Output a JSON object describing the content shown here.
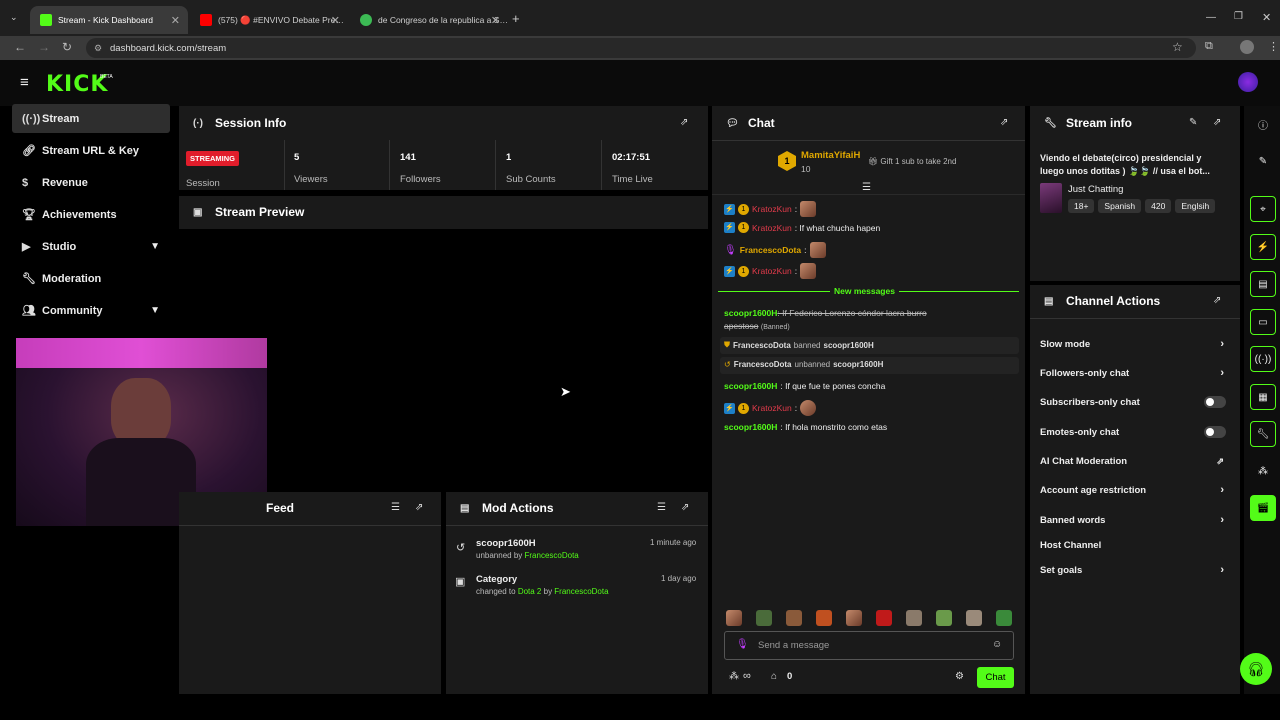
{
  "browser": {
    "tabs": [
      {
        "title": "Stream - Kick Dashboard",
        "active": true
      },
      {
        "title": "(575) 🔴 #ENVIVO Debate Pre…"
      },
      {
        "title": "de Congreso de la republica a S…"
      }
    ],
    "url": "dashboard.kick.com/stream"
  },
  "sidebar": {
    "items": [
      {
        "label": "Stream",
        "icon": "broadcast-icon",
        "selected": true
      },
      {
        "label": "Stream URL & Key",
        "icon": "link-icon"
      },
      {
        "label": "Revenue",
        "icon": "dollar-icon"
      },
      {
        "label": "Achievements",
        "icon": "trophy-icon"
      },
      {
        "label": "Studio",
        "icon": "play-icon",
        "expand": true
      },
      {
        "label": "Moderation",
        "icon": "wrench-icon"
      },
      {
        "label": "Community",
        "icon": "people-icon",
        "expand": true
      }
    ]
  },
  "session": {
    "title": "Session Info",
    "status_badge": "STREAMING",
    "status_label": "Session",
    "stats": [
      {
        "value": "5",
        "label": "Viewers"
      },
      {
        "value": "141",
        "label": "Followers"
      },
      {
        "value": "1",
        "label": "Sub Counts"
      },
      {
        "value": "02:17:51",
        "label": "Time Live"
      }
    ]
  },
  "preview": {
    "title": "Stream Preview"
  },
  "feed": {
    "title": "Feed"
  },
  "mod_actions": {
    "title": "Mod Actions",
    "items": [
      {
        "title": "scoopr1600H",
        "pre": "unbanned by ",
        "highlight": "FrancescoDota",
        "time": "1 minute ago"
      },
      {
        "title": "Category",
        "pre": "changed to ",
        "highlight": "Dota 2",
        "mid": " by ",
        "highlight2": "FrancescoDota",
        "time": "1 day ago"
      }
    ]
  },
  "chat": {
    "title": "Chat",
    "pinned_user": "MamitaYifaiH",
    "pinned_count": "10",
    "pinned_rank": "1",
    "gift_text": "Gift 1 sub to take 2nd",
    "messages": [
      {
        "user": "KratozKun",
        "text": ":",
        "color": "red"
      },
      {
        "user": "KratozKun",
        "text": ": If what chucha hapen",
        "color": "red"
      },
      {
        "user": "FrancescoDota",
        "text": ":",
        "color": "gold"
      },
      {
        "user": "KratozKun",
        "text": ":",
        "color": "red"
      }
    ],
    "new_messages": "New messages",
    "banned_msg": {
      "user": "scoopr1600H",
      "text": ": If Federico Lorenzo cóndor lacra burro",
      "text2": "apestoso",
      "tag": "(Banned)"
    },
    "system": [
      {
        "user": "FrancescoDota",
        "action": "banned",
        "target": "scoopr1600H"
      },
      {
        "user": "FrancescoDota",
        "action": "unbanned",
        "target": "scoopr1600H"
      }
    ],
    "later": [
      {
        "user": "scoopr1600H",
        "text": ": If que fue te pones concha"
      },
      {
        "user": "KratozKun",
        "text": ":"
      },
      {
        "user": "scoopr1600H",
        "text": ": If hola monstrito como etas"
      }
    ],
    "input_placeholder": "Send a message",
    "viewers_symbol": "∞",
    "points": "0",
    "send_label": "Chat"
  },
  "stream_info": {
    "title": "Stream info",
    "stream_title": "Viendo el debate(circo) presidencial y luego unos dotitas ) 🍃🍃 // usa el bot...",
    "category": "Just Chatting",
    "tags": [
      "18+",
      "Spanish",
      "420",
      "Englsih"
    ]
  },
  "channel_actions": {
    "title": "Channel Actions",
    "items": [
      {
        "label": "Slow mode",
        "control": "chevron"
      },
      {
        "label": "Followers-only chat",
        "control": "chevron"
      },
      {
        "label": "Subscribers-only chat",
        "control": "toggle"
      },
      {
        "label": "Emotes-only chat",
        "control": "toggle"
      },
      {
        "label": "AI Chat Moderation",
        "control": "external"
      },
      {
        "label": "Account age restriction",
        "control": "chevron"
      },
      {
        "label": "Banned words",
        "control": "chevron"
      },
      {
        "label": "Host Channel",
        "control": "none"
      },
      {
        "label": "Set goals",
        "control": "chevron"
      }
    ]
  },
  "colors": {
    "accent": "#53fc18",
    "panel": "#1a1a1a",
    "streaming": "#e11d2b"
  }
}
